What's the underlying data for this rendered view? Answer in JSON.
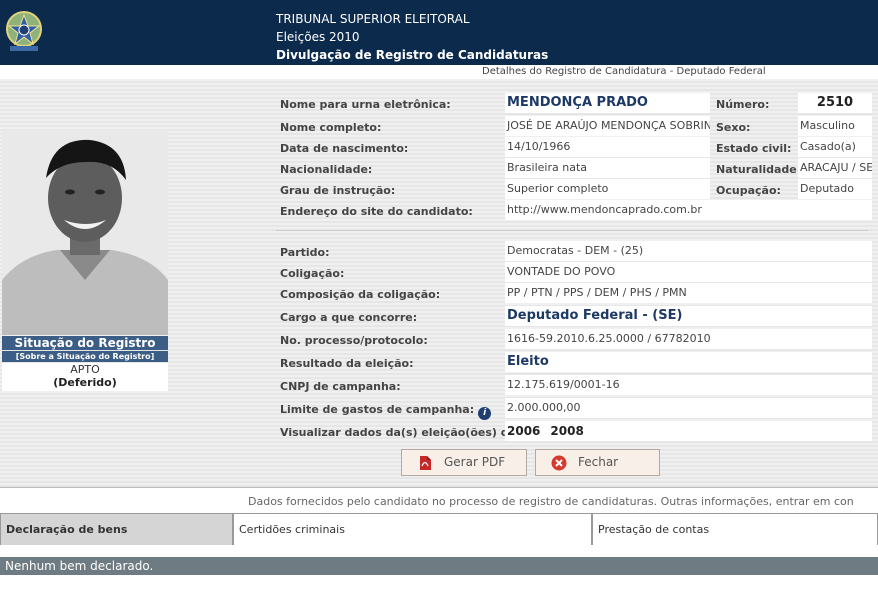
{
  "header": {
    "line1": "TRIBUNAL SUPERIOR ELEITORAL",
    "line2": "Eleições 2010",
    "line3": "Divulgação de Registro de Candidaturas"
  },
  "subtitle": "Detalhes do Registro de Candidatura - Deputado Federal",
  "situacao": {
    "title": "Situação do Registro",
    "link": "[Sobre a Situação do Registro]",
    "status": "APTO",
    "detail": "(Deferido)"
  },
  "personal": {
    "urna_label": "Nome para urna eletrônica:",
    "urna_value": "MENDONÇA PRADO",
    "numero_label": "Número:",
    "numero_value": "2510",
    "completo_label": "Nome completo:",
    "completo_value": "JOSÉ DE ARAÚJO MENDONÇA SOBRINHO",
    "sexo_label": "Sexo:",
    "sexo_value": "Masculino",
    "nasc_label": "Data de nascimento:",
    "nasc_value": "14/10/1966",
    "civil_label": "Estado civil:",
    "civil_value": "Casado(a)",
    "nac_label": "Nacionalidade:",
    "nac_value": "Brasileira nata",
    "nat_label": "Naturalidade:",
    "nat_value": "ARACAJU / SE",
    "grau_label": "Grau de instrução:",
    "grau_value": "Superior completo",
    "ocup_label": "Ocupação:",
    "ocup_value": "Deputado",
    "site_label": "Endereço do site do candidato:",
    "site_value": "http://www.mendoncaprado.com.br"
  },
  "candidacy": {
    "partido_label": "Partido:",
    "partido_value": "Democratas - DEM - (25)",
    "coligacao_label": "Coligação:",
    "coligacao_value": "VONTADE DO POVO",
    "composicao_label": "Composição da coligação:",
    "composicao_value": "PP / PTN / PPS / DEM / PHS / PMN",
    "cargo_label": "Cargo a que concorre:",
    "cargo_value": "Deputado Federal - (SE)",
    "processo_label": "No. processo/protocolo:",
    "processo_value": "1616-59.2010.6.25.0000 / 67782010",
    "resultado_label": "Resultado da eleição:",
    "resultado_value": "Eleito",
    "cnpj_label": "CNPJ de campanha:",
    "cnpj_value": "12.175.619/0001-16",
    "limite_label": "Limite de gastos de campanha:",
    "limite_value": "2.000.000,00",
    "visualizar_label": "Visualizar dados da(s) eleição(ões) de:",
    "years": [
      "2006",
      "2008"
    ]
  },
  "buttons": {
    "pdf": "Gerar PDF",
    "close": "Fechar"
  },
  "info_line": "Dados fornecidos pelo candidato no processo de registro de candidaturas. Outras informações, entrar em con",
  "tabs": [
    "Declaração de bens",
    "Certidões criminais",
    "Prestação de contas"
  ],
  "bens_message": "Nenhum bem declarado.",
  "colors": {
    "header_bg": "#0c2a4c",
    "situacao_bg": "#3b5d86",
    "bar_bg": "#6e7b82",
    "accent_text": "#1d3a66"
  },
  "icons": {
    "crest": "brazil-coat-of-arms-icon",
    "pdf": "pdf-file-icon",
    "close": "close-circle-icon",
    "info": "info-icon"
  }
}
